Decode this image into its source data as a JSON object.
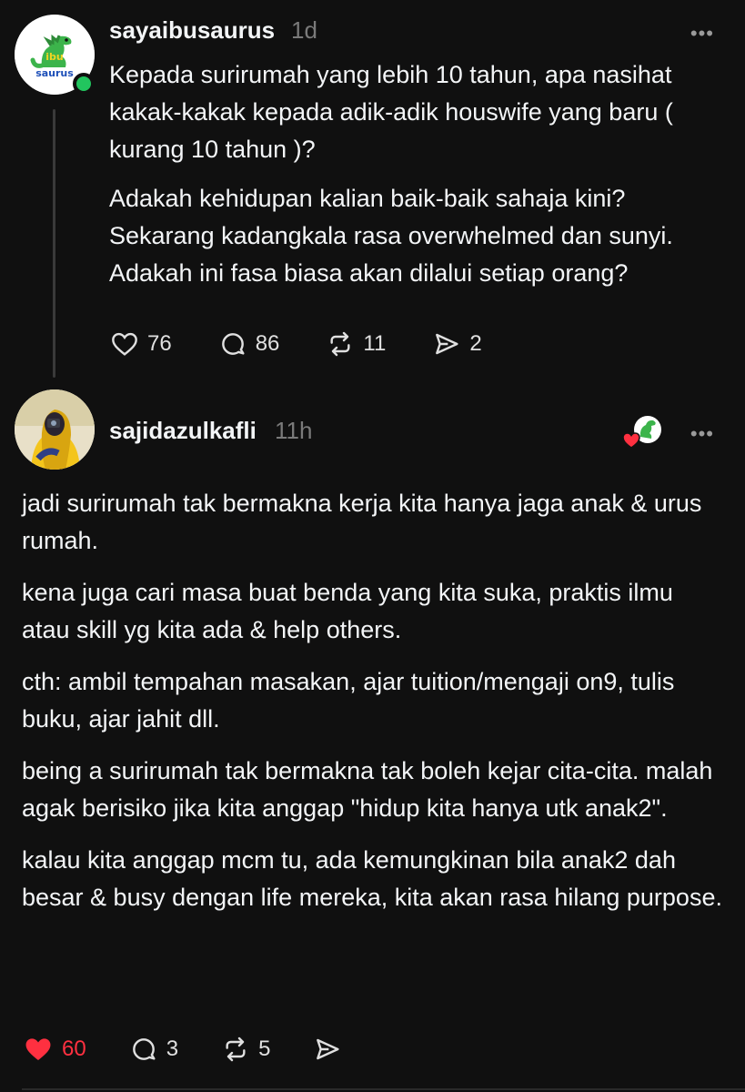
{
  "post1": {
    "username": "sayaibusaurus",
    "time": "1d",
    "avatar_label": "ibu saurus",
    "paragraphs": [
      "Kepada surirumah yang lebih 10 tahun, apa nasihat kakak-kakak kepada adik-adik houswife yang baru ( kurang 10 tahun )?",
      "Adakah kehidupan kalian baik-baik sahaja kini? Sekarang kadangkala rasa overwhelmed dan sunyi. Adakah ini fasa biasa akan dilalui setiap orang?"
    ],
    "likes": "76",
    "comments": "86",
    "reposts": "11",
    "shares": "2",
    "more": "•••"
  },
  "post2": {
    "username": "sajidazulkafli",
    "time": "11h",
    "paragraphs": [
      "jadi surirumah tak bermakna kerja kita hanya jaga anak & urus rumah.",
      "kena juga cari masa buat benda yang kita suka, praktis ilmu atau skill yg kita ada & help others.",
      "cth: ambil tempahan masakan, ajar tuition/mengaji on9, tulis buku, ajar jahit dll.",
      "being a surirumah tak bermakna tak boleh kejar cita-cita. malah agak berisiko jika kita anggap \"hidup kita hanya utk anak2\".",
      "kalau kita anggap mcm tu, ada kemungkinan bila anak2 dah besar & busy dengan life mereka, kita akan rasa hilang purpose."
    ],
    "likes": "60",
    "comments": "3",
    "reposts": "5",
    "more": "•••"
  },
  "colors": {
    "background": "#101010",
    "text": "#f3f5f7",
    "muted": "#7a7a7a",
    "liked": "#ff3040",
    "online": "#22c55e"
  }
}
